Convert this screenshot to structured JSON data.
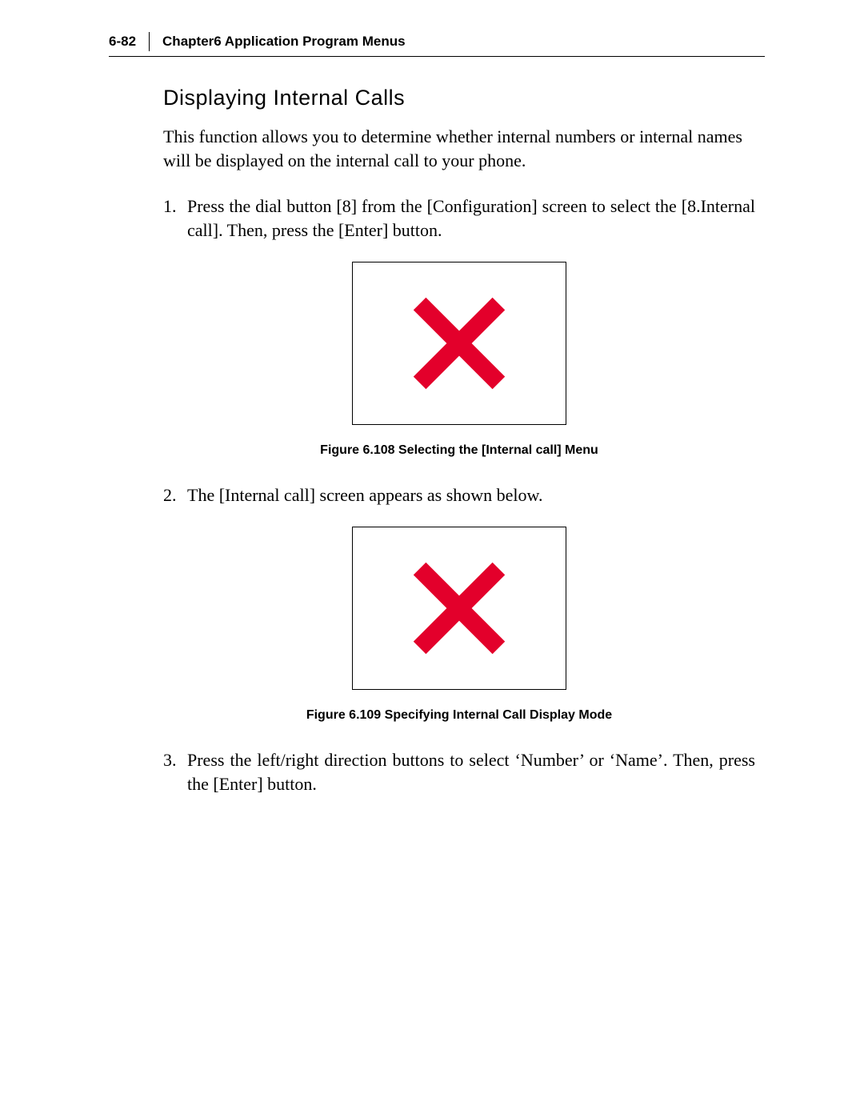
{
  "header": {
    "page_number": "6-82",
    "chapter_title": "Chapter6  Application Program Menus"
  },
  "section": {
    "title": "Displaying Internal Calls",
    "intro": "This function allows you to determine whether internal numbers or internal names will be displayed on the internal call to your phone."
  },
  "steps": [
    {
      "num": "1.",
      "text": "Press the dial button [8] from the [Configuration] screen to select the [8.Internal call]. Then, press the [Enter] button."
    },
    {
      "num": "2.",
      "text": "The [Internal call] screen appears as shown below."
    },
    {
      "num": "3.",
      "text": "Press the left/right direction buttons to select ‘Number’ or ‘Name’. Then, press the [Enter] button."
    }
  ],
  "figures": [
    {
      "caption": "Figure 6.108 Selecting the [Internal call] Menu"
    },
    {
      "caption": "Figure 6.109 Specifying Internal Call Display Mode"
    }
  ],
  "colors": {
    "missing_x": "#e3002b"
  }
}
